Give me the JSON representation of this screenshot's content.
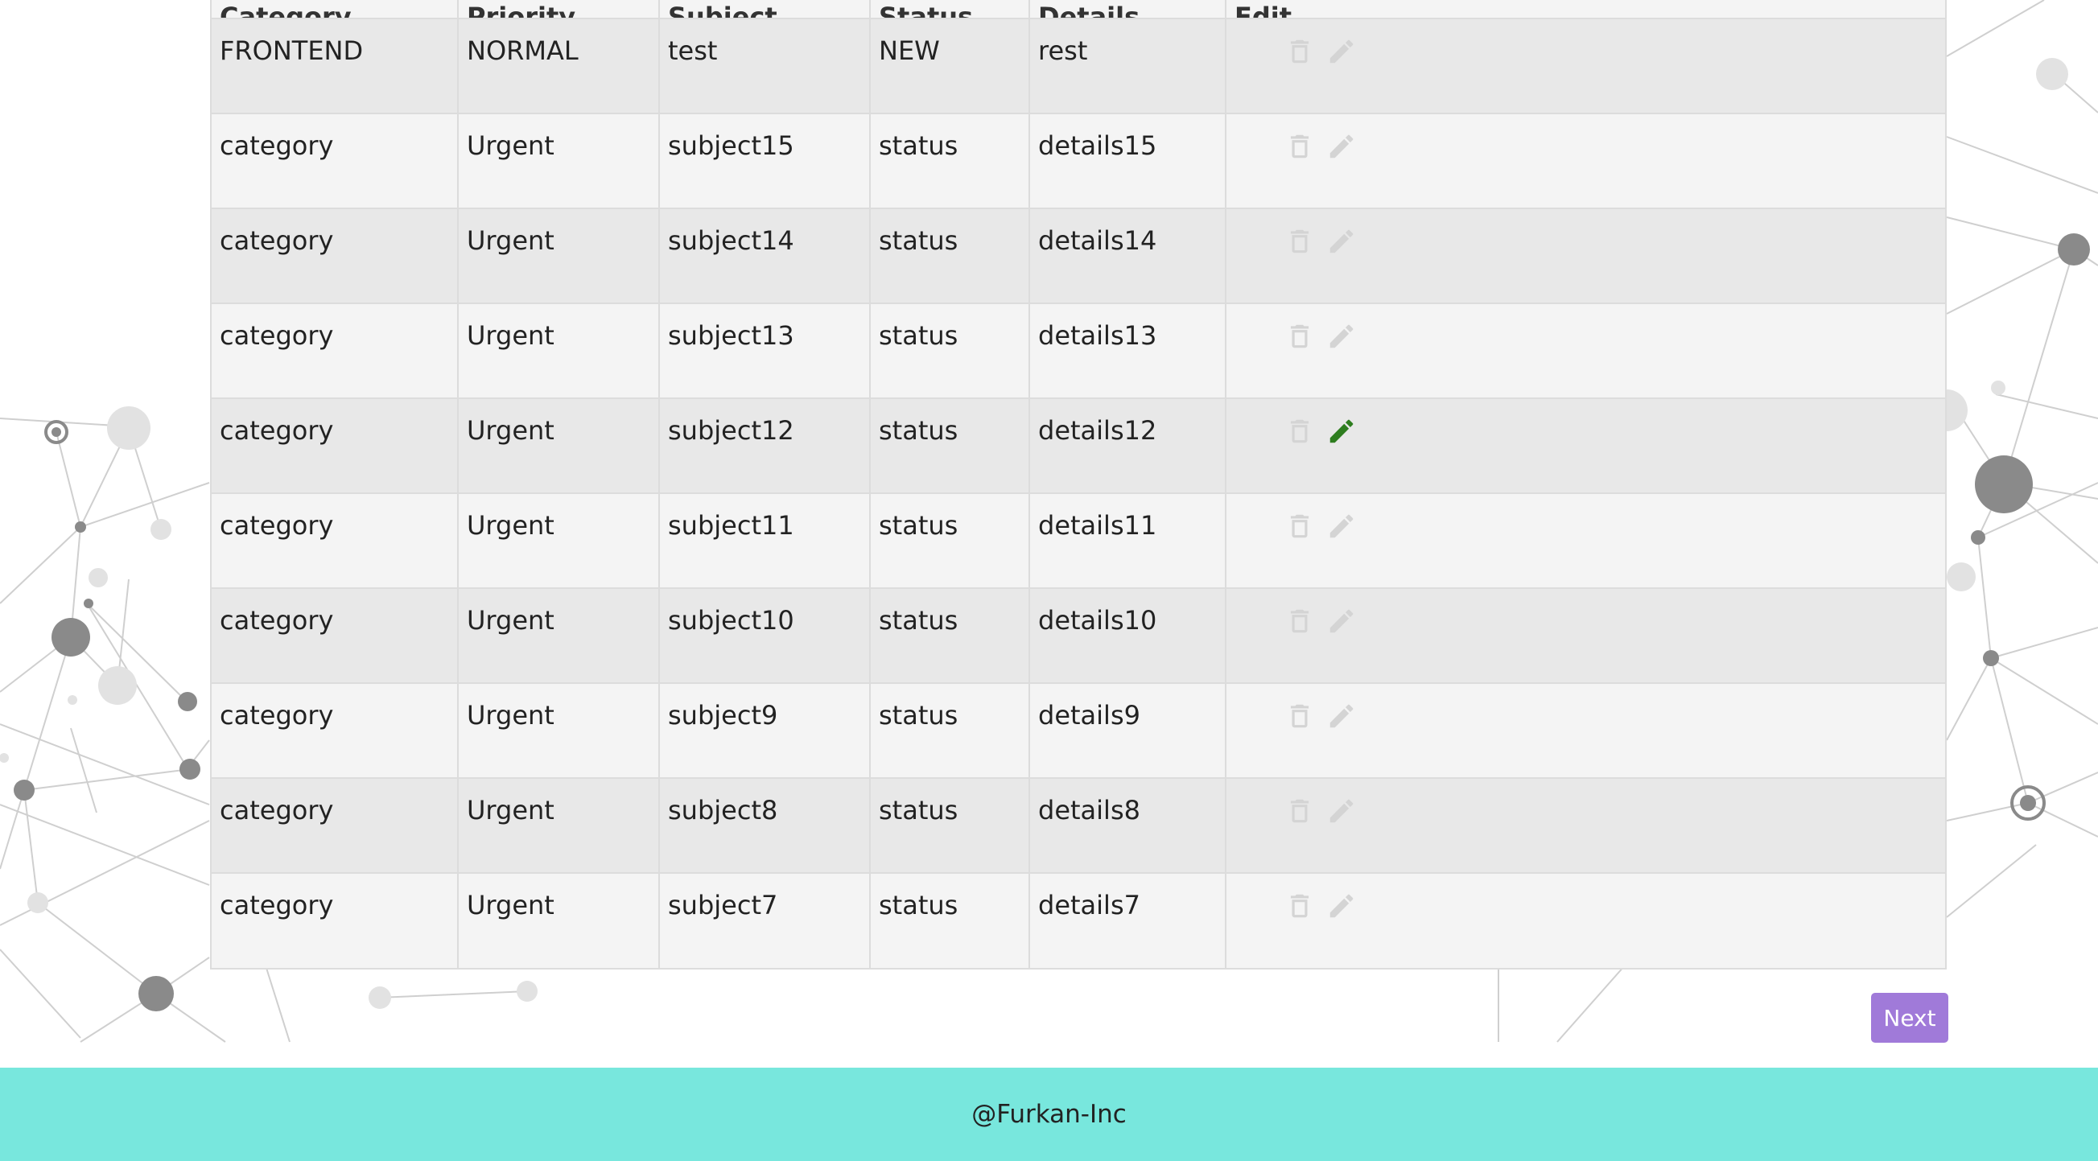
{
  "table": {
    "headers": [
      "Category",
      "Priority",
      "Subject",
      "Status",
      "Details",
      "Edit"
    ],
    "rows": [
      {
        "category": "FRONTEND",
        "priority": "NORMAL",
        "subject": "test",
        "status": "NEW",
        "details": "rest",
        "edit_active": false
      },
      {
        "category": "category",
        "priority": "Urgent",
        "subject": "subject15",
        "status": "status",
        "details": "details15",
        "edit_active": false
      },
      {
        "category": "category",
        "priority": "Urgent",
        "subject": "subject14",
        "status": "status",
        "details": "details14",
        "edit_active": false
      },
      {
        "category": "category",
        "priority": "Urgent",
        "subject": "subject13",
        "status": "status",
        "details": "details13",
        "edit_active": false
      },
      {
        "category": "category",
        "priority": "Urgent",
        "subject": "subject12",
        "status": "status",
        "details": "details12",
        "edit_active": true
      },
      {
        "category": "category",
        "priority": "Urgent",
        "subject": "subject11",
        "status": "status",
        "details": "details11",
        "edit_active": false
      },
      {
        "category": "category",
        "priority": "Urgent",
        "subject": "subject10",
        "status": "status",
        "details": "details10",
        "edit_active": false
      },
      {
        "category": "category",
        "priority": "Urgent",
        "subject": "subject9",
        "status": "status",
        "details": "details9",
        "edit_active": false
      },
      {
        "category": "category",
        "priority": "Urgent",
        "subject": "subject8",
        "status": "status",
        "details": "details8",
        "edit_active": false
      },
      {
        "category": "category",
        "priority": "Urgent",
        "subject": "subject7",
        "status": "status",
        "details": "details7",
        "edit_active": false
      }
    ]
  },
  "icons": {
    "delete": "trash-icon",
    "edit": "pencil-icon"
  },
  "pagination": {
    "next_label": "Next"
  },
  "footer": {
    "text": "@Furkan-Inc"
  },
  "colors": {
    "footer_bg": "#78e7dd",
    "next_button_bg": "#a07ad9",
    "edit_active": "#2e7d1f",
    "icon_inactive": "#d4d4d4",
    "row_odd": "#e8e8e8",
    "row_even": "#f4f4f4"
  }
}
